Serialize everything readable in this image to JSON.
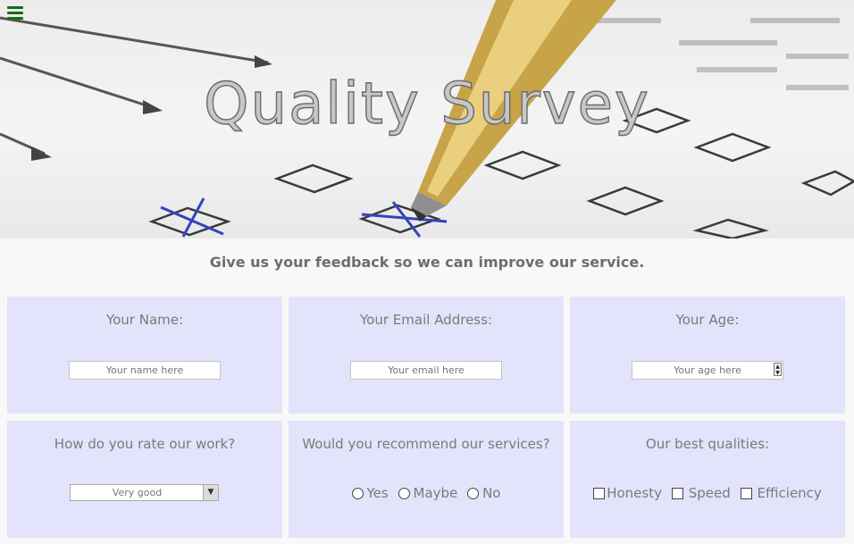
{
  "header": {
    "title": "Quality Survey",
    "menu_icon": "hamburger-menu-icon"
  },
  "subtitle": "Give us your feedback so we can improve our service.",
  "fields": {
    "name": {
      "label": "Your Name:",
      "placeholder": "Your name here"
    },
    "email": {
      "label": "Your Email Address:",
      "placeholder": "Your email here"
    },
    "age": {
      "label": "Your Age:",
      "placeholder": "Your age here"
    },
    "rating": {
      "label": "How do you rate our work?",
      "selected": "Very good"
    },
    "recommend": {
      "label": "Would you recommend our services?",
      "options": [
        "Yes",
        "Maybe",
        "No"
      ]
    },
    "qualities": {
      "label": "Our best qualities:",
      "options": [
        "Honesty",
        "Speed",
        "Efficiency"
      ]
    }
  },
  "colors": {
    "card_bg": "#e3e3fb",
    "menu_icon": "#1a6b1a",
    "page_bg": "#f8f8f8"
  }
}
